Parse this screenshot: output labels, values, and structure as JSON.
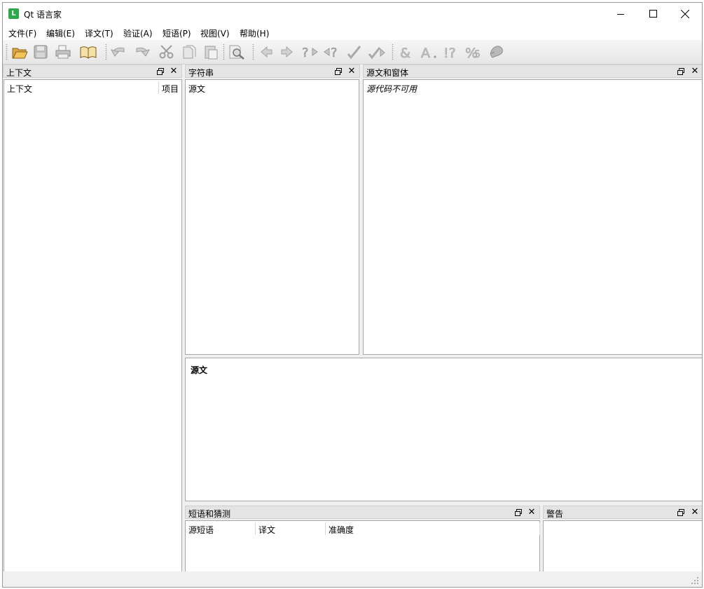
{
  "window": {
    "title": "Qt 语言家",
    "icon": "linguist-app-icon",
    "accent": "#2da84a"
  },
  "menu": [
    "文件(F)",
    "编辑(E)",
    "译文(T)",
    "验证(A)",
    "短语(P)",
    "视图(V)",
    "帮助(H)"
  ],
  "toolbar": [
    "open-icon",
    "save-icon",
    "print-icon",
    "phrasebook-icon",
    "undo-icon",
    "redo-icon",
    "cut-icon",
    "copy-icon",
    "paste-icon",
    "find-icon",
    "prev-icon",
    "next-icon",
    "prev-unfinished-icon",
    "next-unfinished-icon",
    "done-icon",
    "done-and-next-icon",
    "accelerator-check-icon",
    "punctuation-check-icon",
    "phrase-check-icon",
    "placeholder-check-icon",
    "surrounding-whitespace-icon"
  ],
  "docks": {
    "context": {
      "title": "上下文",
      "col1": "上下文",
      "col2": "项目"
    },
    "strings": {
      "title": "字符串",
      "col1": "源文"
    },
    "sources": {
      "title": "源文和窗体",
      "message": "源代码不可用"
    },
    "editor": {
      "source_label": "源文"
    },
    "phrases": {
      "title": "短语和猜测",
      "col1": "源短语",
      "col2": "译文",
      "col3": "准确度"
    },
    "warnings": {
      "title": "警告"
    }
  }
}
